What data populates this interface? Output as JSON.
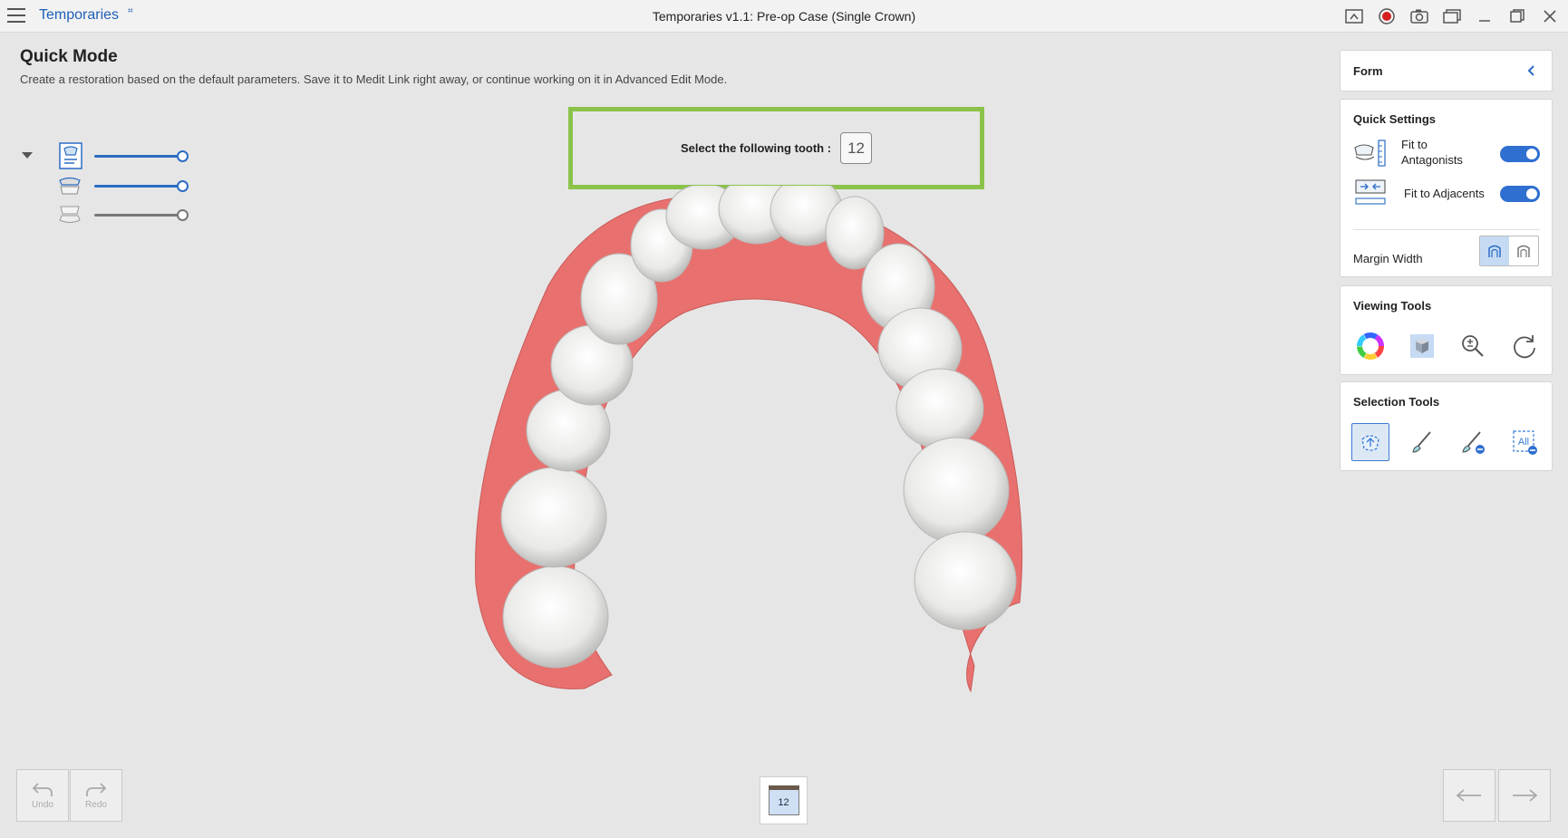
{
  "app": {
    "name": "Temporaries",
    "window_title": "Temporaries v1.1: Pre-op Case (Single Crown)"
  },
  "header": {
    "title": "Quick Mode",
    "description": "Create a restoration based on the default parameters. Save it to Medit Link right away, or continue working on it in Advanced Edit Mode."
  },
  "instruction": {
    "label": "Select the following tooth :",
    "tooth": "12"
  },
  "layers": [
    {
      "name": "restoration-layer",
      "opacity": 1.0,
      "color": "#2b6cc4"
    },
    {
      "name": "scan-layer",
      "opacity": 1.0,
      "color": "#2b6cc4"
    },
    {
      "name": "antagonist-layer",
      "opacity": 1.0,
      "color": "#777777"
    }
  ],
  "form_panel": {
    "title": "Form"
  },
  "quick_settings": {
    "title": "Quick Settings",
    "fit_to_antagonists": "Fit to\nAntagonists",
    "fit_to_antagonists_on": true,
    "fit_to_adjacents": "Fit to Adjacents",
    "fit_to_adjacents_on": true,
    "margin_width": "Margin Width"
  },
  "viewing_tools": {
    "title": "Viewing Tools",
    "icons": [
      "color-wheel-icon",
      "cube-view-icon",
      "zoom-icon",
      "reset-view-icon"
    ]
  },
  "selection_tools": {
    "title": "Selection Tools",
    "icons": [
      "smart-select-icon",
      "brush-icon",
      "brush-deselect-icon",
      "deselect-all-icon"
    ],
    "all_label": "All"
  },
  "bottom": {
    "undo": "Undo",
    "redo": "Redo",
    "tooth_tab": "12"
  },
  "colors": {
    "accent": "#2f6fd0",
    "highlight": "#8bc34a",
    "gum": "#e8716f",
    "tooth": "#f2f2f0"
  }
}
